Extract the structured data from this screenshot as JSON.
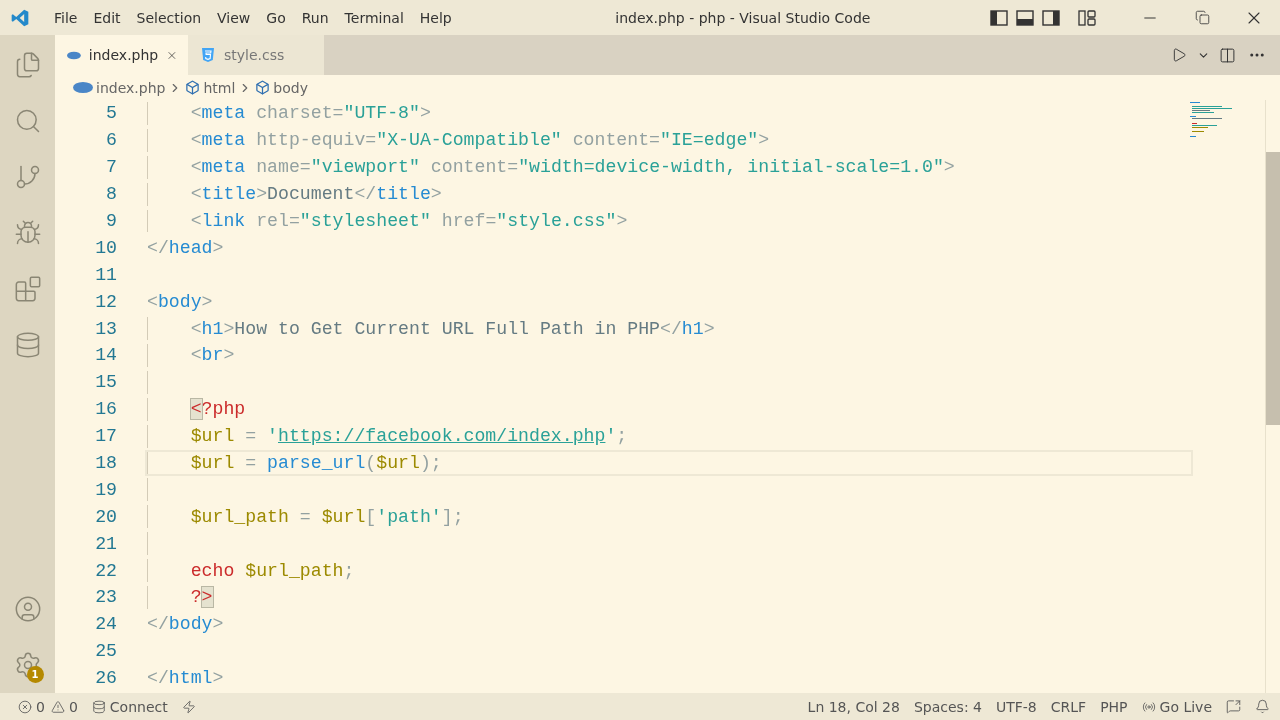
{
  "window": {
    "title": "index.php - php - Visual Studio Code"
  },
  "menu": [
    "File",
    "Edit",
    "Selection",
    "View",
    "Go",
    "Run",
    "Terminal",
    "Help"
  ],
  "tabs": [
    {
      "label": "index.php",
      "kind": "php",
      "selected": true
    },
    {
      "label": "style.css",
      "kind": "css",
      "selected": false
    }
  ],
  "breadcrumbs": [
    {
      "label": "index.php",
      "kind": "php"
    },
    {
      "label": "html",
      "kind": "element"
    },
    {
      "label": "body",
      "kind": "element"
    }
  ],
  "activity_bar": {
    "settings_badge": "1"
  },
  "editor": {
    "lines": [
      {
        "number": "5",
        "current": false,
        "indented": true,
        "tokens": [
          {
            "text": "<",
            "kind": "punct"
          },
          {
            "text": "meta",
            "kind": "tag"
          },
          {
            "text": " charset",
            "kind": "attr"
          },
          {
            "text": "=",
            "kind": "punct"
          },
          {
            "text": "\"UTF-8\"",
            "kind": "string"
          },
          {
            "text": ">",
            "kind": "punct"
          }
        ]
      },
      {
        "number": "6",
        "current": false,
        "indented": true,
        "tokens": [
          {
            "text": "<",
            "kind": "punct"
          },
          {
            "text": "meta",
            "kind": "tag"
          },
          {
            "text": " http-equiv",
            "kind": "attr"
          },
          {
            "text": "=",
            "kind": "punct"
          },
          {
            "text": "\"X-UA-Compatible\"",
            "kind": "string"
          },
          {
            "text": " content",
            "kind": "attr"
          },
          {
            "text": "=",
            "kind": "punct"
          },
          {
            "text": "\"IE=edge\"",
            "kind": "string"
          },
          {
            "text": ">",
            "kind": "punct"
          }
        ]
      },
      {
        "number": "7",
        "current": false,
        "indented": true,
        "tokens": [
          {
            "text": "<",
            "kind": "punct"
          },
          {
            "text": "meta",
            "kind": "tag"
          },
          {
            "text": " name",
            "kind": "attr"
          },
          {
            "text": "=",
            "kind": "punct"
          },
          {
            "text": "\"viewport\"",
            "kind": "string"
          },
          {
            "text": " content",
            "kind": "attr"
          },
          {
            "text": "=",
            "kind": "punct"
          },
          {
            "text": "\"width=device-width, initial-scale=1.0\"",
            "kind": "string"
          },
          {
            "text": ">",
            "kind": "punct"
          }
        ]
      },
      {
        "number": "8",
        "current": false,
        "indented": true,
        "tokens": [
          {
            "text": "<",
            "kind": "punct"
          },
          {
            "text": "title",
            "kind": "tag"
          },
          {
            "text": ">",
            "kind": "punct"
          },
          {
            "text": "Document",
            "kind": "text"
          },
          {
            "text": "</",
            "kind": "punct"
          },
          {
            "text": "title",
            "kind": "tag"
          },
          {
            "text": ">",
            "kind": "punct"
          }
        ]
      },
      {
        "number": "9",
        "current": false,
        "indented": true,
        "tokens": [
          {
            "text": "<",
            "kind": "punct"
          },
          {
            "text": "link",
            "kind": "tag"
          },
          {
            "text": " rel",
            "kind": "attr"
          },
          {
            "text": "=",
            "kind": "punct"
          },
          {
            "text": "\"stylesheet\"",
            "kind": "string"
          },
          {
            "text": " href",
            "kind": "attr"
          },
          {
            "text": "=",
            "kind": "punct"
          },
          {
            "text": "\"style.css\"",
            "kind": "string"
          },
          {
            "text": ">",
            "kind": "punct"
          }
        ]
      },
      {
        "number": "10",
        "current": false,
        "indented": false,
        "tokens": [
          {
            "text": "</",
            "kind": "punct"
          },
          {
            "text": "head",
            "kind": "tag"
          },
          {
            "text": ">",
            "kind": "punct"
          }
        ]
      },
      {
        "number": "11",
        "current": false,
        "indented": false
      },
      {
        "number": "12",
        "current": false,
        "indented": false,
        "tokens": [
          {
            "text": "<",
            "kind": "punct"
          },
          {
            "text": "body",
            "kind": "tag"
          },
          {
            "text": ">",
            "kind": "punct"
          }
        ]
      },
      {
        "number": "13",
        "current": false,
        "indented": true,
        "tokens": [
          {
            "text": "<",
            "kind": "punct"
          },
          {
            "text": "h1",
            "kind": "tag"
          },
          {
            "text": ">",
            "kind": "punct"
          },
          {
            "text": "How to Get Current URL Full Path in PHP",
            "kind": "text"
          },
          {
            "text": "</",
            "kind": "punct"
          },
          {
            "text": "h1",
            "kind": "tag"
          },
          {
            "text": ">",
            "kind": "punct"
          }
        ]
      },
      {
        "number": "14",
        "current": false,
        "indented": true,
        "tokens": [
          {
            "text": "<",
            "kind": "punct"
          },
          {
            "text": "br",
            "kind": "tag"
          },
          {
            "text": ">",
            "kind": "punct"
          }
        ]
      },
      {
        "number": "15",
        "current": false,
        "indented": true
      },
      {
        "number": "16",
        "current": false,
        "indented": true,
        "tokens": [
          {
            "text": "<",
            "kind": "match"
          },
          {
            "text": "?php",
            "kind": "php"
          }
        ]
      },
      {
        "number": "17",
        "current": false,
        "indented": true,
        "tokens": [
          {
            "text": "$url",
            "kind": "var"
          },
          {
            "text": " = ",
            "kind": "punct"
          },
          {
            "text": "'",
            "kind": "string"
          },
          {
            "text": "https://facebook.com/index.php",
            "kind": "link"
          },
          {
            "text": "'",
            "kind": "string"
          },
          {
            "text": ";",
            "kind": "punct"
          }
        ]
      },
      {
        "number": "18",
        "current": true,
        "indented": true,
        "tokens": [
          {
            "text": "$url",
            "kind": "var"
          },
          {
            "text": " = ",
            "kind": "punct"
          },
          {
            "text": "parse_url",
            "kind": "func"
          },
          {
            "text": "(",
            "kind": "punct"
          },
          {
            "text": "$url",
            "kind": "var"
          },
          {
            "text": ");",
            "kind": "punct"
          }
        ]
      },
      {
        "number": "19",
        "current": false,
        "indented": true
      },
      {
        "number": "20",
        "current": false,
        "indented": true,
        "tokens": [
          {
            "text": "$url_path",
            "kind": "var"
          },
          {
            "text": " = ",
            "kind": "punct"
          },
          {
            "text": "$url",
            "kind": "var"
          },
          {
            "text": "[",
            "kind": "punct"
          },
          {
            "text": "'path'",
            "kind": "string"
          },
          {
            "text": "];",
            "kind": "punct"
          }
        ]
      },
      {
        "number": "21",
        "current": false,
        "indented": true
      },
      {
        "number": "22",
        "current": false,
        "indented": true,
        "tokens": [
          {
            "text": "echo ",
            "kind": "php"
          },
          {
            "text": "$url_path",
            "kind": "var"
          },
          {
            "text": ";",
            "kind": "punct"
          }
        ]
      },
      {
        "number": "23",
        "current": false,
        "indented": true,
        "tokens": [
          {
            "text": "?",
            "kind": "php"
          },
          {
            "text": ">",
            "kind": "match"
          }
        ]
      },
      {
        "number": "24",
        "current": false,
        "indented": false,
        "tokens": [
          {
            "text": "</",
            "kind": "punct"
          },
          {
            "text": "body",
            "kind": "tag"
          },
          {
            "text": ">",
            "kind": "punct"
          }
        ]
      },
      {
        "number": "25",
        "current": false,
        "indented": false
      },
      {
        "number": "26",
        "current": false,
        "indented": false,
        "tokens": [
          {
            "text": "</",
            "kind": "punct"
          },
          {
            "text": "html",
            "kind": "tag"
          },
          {
            "text": ">",
            "kind": "punct"
          }
        ]
      }
    ]
  },
  "status_bar": {
    "errors": "0",
    "warnings": "0",
    "connect": "Connect",
    "position": "Ln 18, Col 28",
    "spaces": "Spaces: 4",
    "encoding": "UTF-8",
    "eol": "CRLF",
    "language": "PHP",
    "go_live": "Go Live"
  }
}
